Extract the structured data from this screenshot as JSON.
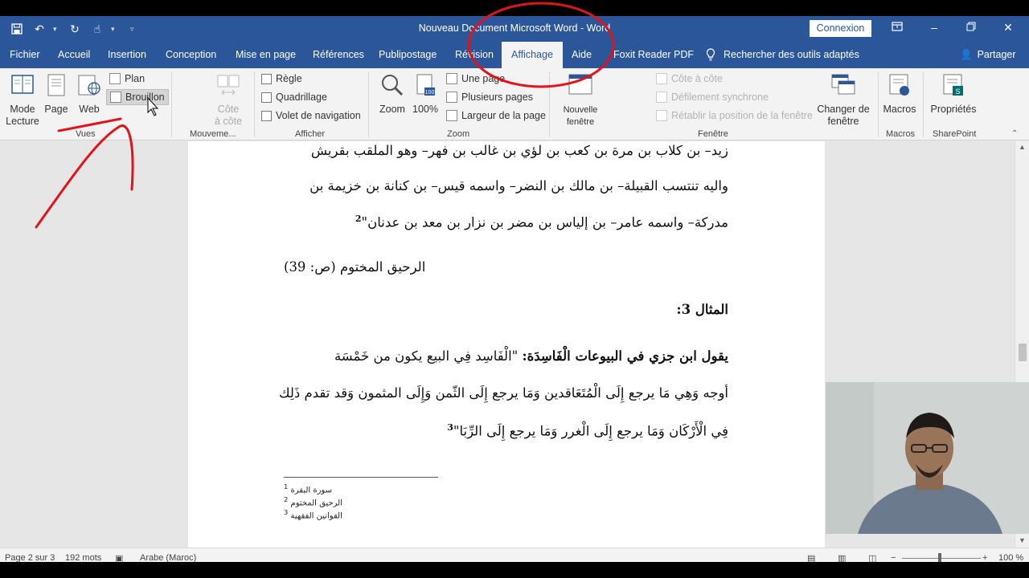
{
  "window": {
    "title": "Nouveau Document Microsoft Word  -  Word",
    "connexion_label": "Connexion"
  },
  "tabs": [
    "Fichier",
    "Accueil",
    "Insertion",
    "Conception",
    "Mise en page",
    "Références",
    "Publipostage",
    "Révision",
    "Affichage",
    "Aide",
    "Foxit Reader PDF"
  ],
  "active_tab": "Affichage",
  "tell_me": "Rechercher des outils adaptés",
  "share_label": "Partager",
  "ribbon": {
    "vues": {
      "label": "Vues",
      "mode_lecture": "Mode\nLecture",
      "mode_lecture_line1": "Mode",
      "mode_lecture_line2": "Lecture",
      "page": "Page",
      "web": "Web",
      "plan": "Plan",
      "brouillon": "Brouillon"
    },
    "mouvement": {
      "label": "Mouveme...",
      "cote_line1": "Côte",
      "cote_line2": "à côte"
    },
    "afficher": {
      "label": "Afficher",
      "regle": "Règle",
      "quadrillage": "Quadrillage",
      "volet": "Volet de navigation"
    },
    "zoom": {
      "label": "Zoom",
      "zoom_btn": "Zoom",
      "pct_btn": "100%",
      "une_page": "Une page",
      "plusieurs_pages": "Plusieurs pages",
      "largeur": "Largeur de la page"
    },
    "fenetre": {
      "label": "Fenêtre",
      "nouvelle_line1": "Nouvelle",
      "nouvelle_line2": "fenêtre",
      "cote_a_cote": "Côte à côte",
      "defilement": "Défilement synchrone",
      "retablir": "Rétablir la position de la fenêtre",
      "changer_line1": "Changer de",
      "changer_line2": "fenêtre"
    },
    "macros": {
      "label": "Macros",
      "btn": "Macros"
    },
    "sharepoint": {
      "label": "SharePoint",
      "btn": "Propriétés"
    }
  },
  "document": {
    "line1": "زيد– بن كلاب بن مرة بن كعب بن لؤي بن غالب بن فهر– وهو الملقب بقريش",
    "line2": "واليه تنتسب القبيلة– بن مالك بن النضر– واسمه قيس– بن كنانة بن خزيمة بن",
    "line3": "مدركة– واسمه عامر– بن إلياس بن مضر بن نزار بن معد بن عدنان\"",
    "line3_sup": "2",
    "citation": "الرحيق المختوم (ص: 39)",
    "heading": "المثال 3:",
    "para_bold": "يقول ابن جزي في البيوعات الْفَاسِدَة:",
    "para_rest": " \"الْفَاسِد فِي البيع يكون من خَمْسَة",
    "line5": "أوجه وَهِي مَا يرجع إِلَى الْمُتَعَاقدين وَمَا يرجع إِلَى الثّمن وَإِلَى المثمون وَقد تقدم ذَلِك",
    "line6": "فِي الْأَرْكَان وَمَا يرجع إِلَى الْغرر وَمَا يرجع إِلَى الرِّبَا\"",
    "line6_sup": "3",
    "footnotes": [
      {
        "num": "1",
        "text": "سورة البقرة"
      },
      {
        "num": "2",
        "text": "الرحيق المختوم"
      },
      {
        "num": "3",
        "text": "القوانين الفقهية"
      }
    ]
  },
  "statusbar": {
    "page": "Page 2 sur 3",
    "words": "192 mots",
    "language": "Arabe (Maroc)",
    "zoom": "100 %"
  },
  "colors": {
    "word_blue": "#2b579a",
    "annotation_red": "#e0141b"
  }
}
